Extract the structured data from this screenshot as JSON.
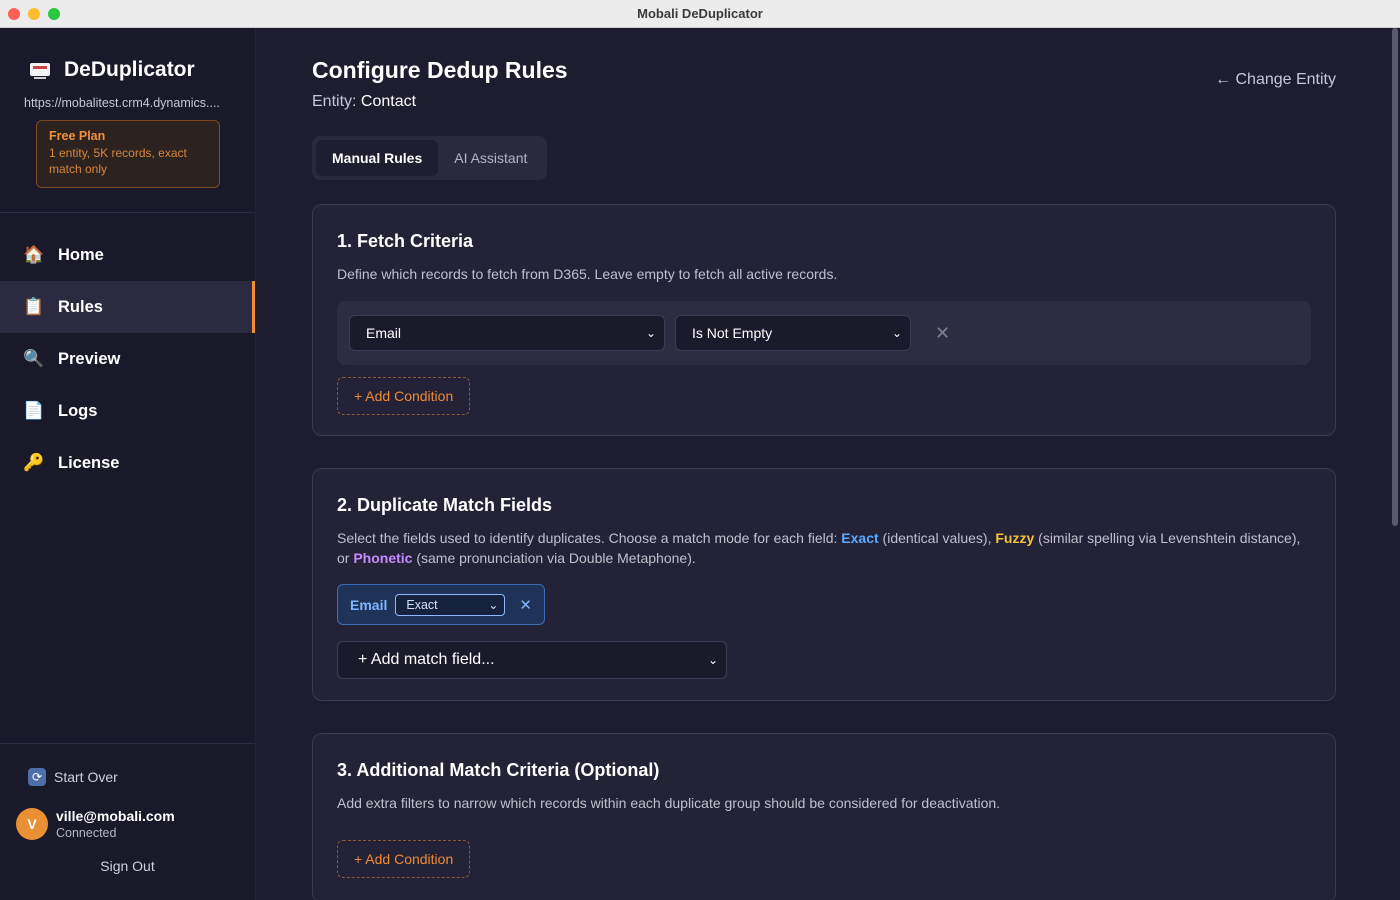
{
  "window": {
    "title": "Mobali DeDuplicator"
  },
  "sidebar": {
    "brand": "DeDuplicator",
    "url": "https://mobalitest.crm4.dynamics....",
    "plan": {
      "title": "Free Plan",
      "description": "1 entity, 5K records, exact match only"
    },
    "items": [
      {
        "label": "Home",
        "icon": "house-icon",
        "glyph": "🏠"
      },
      {
        "label": "Rules",
        "icon": "clipboard-icon",
        "glyph": "📋"
      },
      {
        "label": "Preview",
        "icon": "magnifier-icon",
        "glyph": "🔍"
      },
      {
        "label": "Logs",
        "icon": "document-icon",
        "glyph": "📄"
      },
      {
        "label": "License",
        "icon": "key-icon",
        "glyph": "🔑"
      }
    ],
    "active_item": "Rules",
    "start_over": "Start Over",
    "user": {
      "initial": "V",
      "email": "ville@mobali.com",
      "status": "Connected"
    },
    "sign_out": "Sign Out"
  },
  "header": {
    "title": "Configure Dedup Rules",
    "entity_label": "Entity:",
    "entity_value": "Contact",
    "change_entity": "← Change Entity"
  },
  "tabs": [
    {
      "label": "Manual Rules",
      "active": true
    },
    {
      "label": "AI Assistant",
      "active": false
    }
  ],
  "fetch_criteria": {
    "title": "1. Fetch Criteria",
    "description": "Define which records to fetch from D365. Leave empty to fetch all active records.",
    "conditions": [
      {
        "field": "Email",
        "operator": "Is Not Empty"
      }
    ],
    "add_condition": "+ Add Condition"
  },
  "match_fields": {
    "title": "2. Duplicate Match Fields",
    "desc_part1": "Select the fields used to identify duplicates. Choose a match mode for each field: ",
    "kw_exact": "Exact",
    "desc_part2": " (identical values), ",
    "kw_fuzzy": "Fuzzy",
    "desc_part3": " (similar spelling via Levenshtein distance), or ",
    "kw_phonetic": "Phonetic",
    "desc_part4": " (same pronunciation via Double Metaphone).",
    "fields": [
      {
        "name": "Email",
        "mode": "Exact"
      }
    ],
    "add_field_placeholder": "+ Add match field..."
  },
  "additional_criteria": {
    "title": "3. Additional Match Criteria (Optional)",
    "description": "Add extra filters to narrow which records within each duplicate group should be considered for deactivation.",
    "add_condition": "+ Add Condition"
  },
  "colors": {
    "accent": "#f08a36",
    "exact": "#5aa9ff",
    "fuzzy": "#f5c13a",
    "phonetic": "#c48cff"
  }
}
